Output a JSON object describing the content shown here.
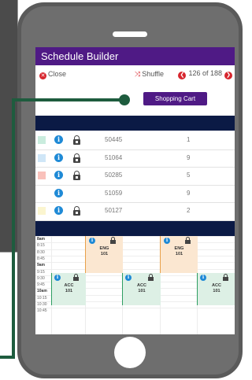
{
  "app": {
    "title": "Schedule Builder"
  },
  "controls": {
    "close_label": "Close",
    "shuffle_label": "Shuffle",
    "page_current": 126,
    "page_total": 188,
    "page_label": "126 of 188",
    "cart_button": "Shopping Cart"
  },
  "courses": [
    {
      "color": "#c9ecdd",
      "locked": true,
      "crn": "50445",
      "count": "1"
    },
    {
      "color": "#cfe6f7",
      "locked": true,
      "crn": "51064",
      "count": "9"
    },
    {
      "color": "#f9c1bb",
      "locked": true,
      "crn": "50285",
      "count": "5"
    },
    {
      "color": "",
      "locked": false,
      "crn": "51059",
      "count": "9"
    },
    {
      "color": "#fbf5cf",
      "locked": true,
      "crn": "50127",
      "count": "2"
    }
  ],
  "calendar": {
    "times": [
      "8am",
      "8:15",
      "8:30",
      "8:45",
      "9am",
      "9:15",
      "9:30",
      "9:45",
      "10am",
      "10:15",
      "10:30",
      "10:45"
    ],
    "events": [
      {
        "course": "ENG",
        "number": "101",
        "kind": "eng"
      },
      {
        "course": "ENG",
        "number": "101",
        "kind": "eng"
      },
      {
        "course": "ACC",
        "number": "101",
        "kind": "acc"
      },
      {
        "course": "ACC",
        "number": "101",
        "kind": "acc"
      },
      {
        "course": "ACC",
        "number": "101",
        "kind": "acc"
      }
    ]
  },
  "colors": {
    "brand_purple": "#4f1a85",
    "navy": "#0b1a45",
    "accent_red": "#d7262e",
    "info_blue": "#1f8ad6",
    "connector_green": "#1e5c3e"
  },
  "icons": {
    "close": "close-circle-icon",
    "shuffle": "shuffle-icon",
    "prev": "chevron-left-circle-icon",
    "next": "chevron-right-circle-icon",
    "info": "info-icon",
    "lock": "lock-icon"
  }
}
